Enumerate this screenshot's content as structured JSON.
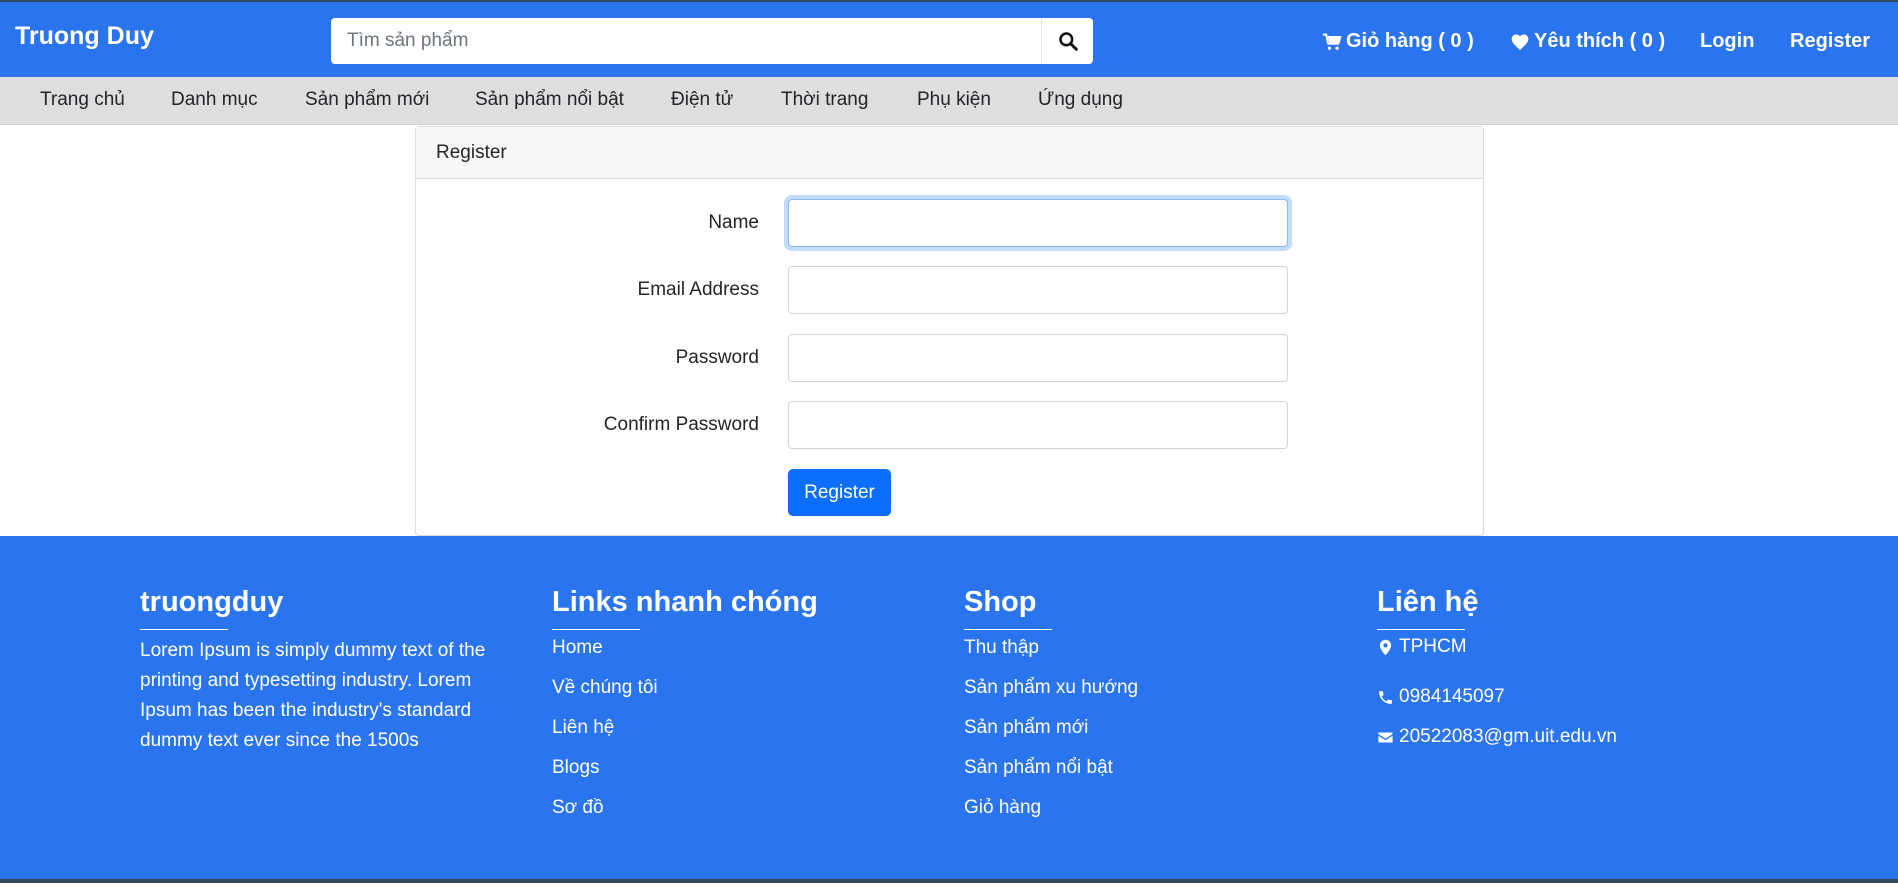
{
  "header": {
    "brand": "Truong Duy",
    "search_placeholder": "Tìm sản phẩm",
    "cart_label": "Giỏ hàng ( 0 )",
    "wishlist_label": "Yêu thích ( 0 )",
    "login_label": "Login",
    "register_label": "Register"
  },
  "menu": {
    "items": [
      "Trang chủ",
      "Danh mục",
      "Sản phẩm mới",
      "Sản phẩm nổi bật",
      "Điện tử",
      "Thời trang",
      "Phụ kiện",
      "Ứng dụng"
    ]
  },
  "form": {
    "title": "Register",
    "name_label": "Name",
    "email_label": "Email Address",
    "password_label": "Password",
    "confirm_label": "Confirm Password",
    "name_value": "",
    "email_value": "",
    "password_value": "",
    "confirm_value": "",
    "submit_label": "Register"
  },
  "footer": {
    "about": {
      "title": "truongduy",
      "text": "Lorem Ipsum is simply dummy text of the printing and typesetting industry. Lorem Ipsum has been the industry's standard dummy text ever since the 1500s"
    },
    "links": {
      "title": "Links nhanh chóng",
      "items": [
        "Home",
        "Về chúng tôi",
        "Liên hệ",
        "Blogs",
        "Sơ đồ"
      ]
    },
    "shop": {
      "title": "Shop",
      "items": [
        "Thu thập",
        "Sản phẩm xu hướng",
        "Sản phẩm mới",
        "Sản phẩm nổi bật",
        "Giỏ hàng"
      ]
    },
    "contact": {
      "title": "Liên hệ",
      "address": "TPHCM",
      "phone": "0984145097",
      "email": "20522083@gm.uit.edu.vn"
    }
  },
  "colors": {
    "primary_blue": "#2a75ee",
    "button_blue": "#0d6efd",
    "menu_gray": "#dedede"
  },
  "icons": [
    "search-icon",
    "cart-icon",
    "heart-icon",
    "map-marker-icon",
    "phone-icon",
    "envelope-icon"
  ]
}
